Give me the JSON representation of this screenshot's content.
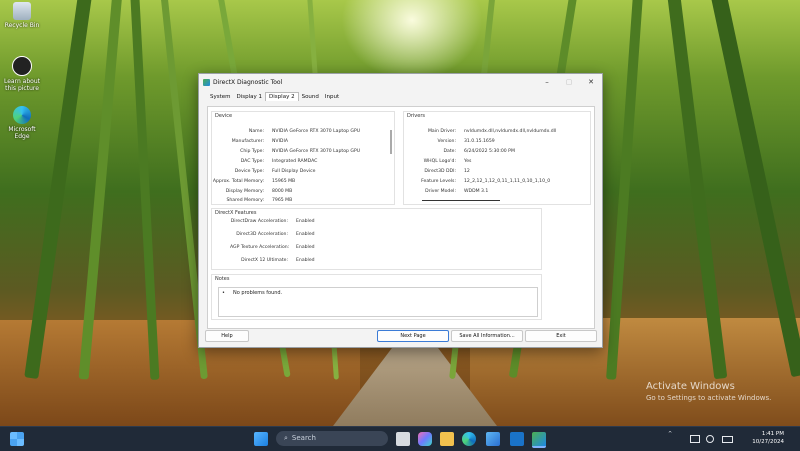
{
  "desktop": {
    "icons": [
      {
        "label": "Recycle Bin",
        "icon": "recycle-bin-icon"
      },
      {
        "label": "Learn about this picture",
        "icon": "learn-about-picture-icon"
      },
      {
        "label": "Microsoft Edge",
        "icon": "edge-icon"
      }
    ],
    "activate": {
      "title": "Activate Windows",
      "subtitle": "Go to Settings to activate Windows."
    }
  },
  "window": {
    "title": "DirectX Diagnostic Tool",
    "controls": {
      "minimize": "–",
      "maximize": "▢",
      "close": "✕"
    },
    "tabs": [
      "System",
      "Display 1",
      "Display 2",
      "Sound",
      "Input"
    ],
    "active_tab": "Display 2",
    "device": {
      "title": "Device",
      "rows": [
        {
          "k": "Name:",
          "v": "NVIDIA GeForce RTX 3070 Laptop GPU"
        },
        {
          "k": "Manufacturer:",
          "v": "NVIDIA"
        },
        {
          "k": "Chip Type:",
          "v": "NVIDIA GeForce RTX 3070 Laptop GPU"
        },
        {
          "k": "DAC Type:",
          "v": "Integrated RAMDAC"
        },
        {
          "k": "Device Type:",
          "v": "Full Display Device"
        },
        {
          "k": "Approx. Total Memory:",
          "v": "15965 MB"
        },
        {
          "k": "Display Memory:",
          "v": "8000 MB"
        },
        {
          "k": "Shared Memory:",
          "v": "7965 MB"
        }
      ]
    },
    "drivers": {
      "title": "Drivers",
      "rows": [
        {
          "k": "Main Driver:",
          "v": "nvldumdx.dll,nvldumdx.dll,nvldumdx.dll"
        },
        {
          "k": "Version:",
          "v": "31.0.15.1659"
        },
        {
          "k": "Date:",
          "v": "6/24/2022 5:30:00 PM"
        },
        {
          "k": "WHQL Logo'd:",
          "v": "Yes"
        },
        {
          "k": "Direct3D DDI:",
          "v": "12"
        },
        {
          "k": "Feature Levels:",
          "v": "12_2,12_1,12_0,11_1,11_0,10_1,10_0"
        },
        {
          "k": "Driver Model:",
          "v": "WDDM 3.1"
        }
      ]
    },
    "features": {
      "title": "DirectX Features",
      "rows": [
        {
          "k": "DirectDraw Acceleration:",
          "v": "Enabled"
        },
        {
          "k": "Direct3D Acceleration:",
          "v": "Enabled"
        },
        {
          "k": "AGP Texture Acceleration:",
          "v": "Enabled"
        },
        {
          "k": "DirectX 12 Ultimate:",
          "v": "Enabled"
        }
      ]
    },
    "notes": {
      "title": "Notes",
      "bullet": "•",
      "text": "No problems found."
    },
    "buttons": {
      "help": "Help",
      "next_page": "Next Page",
      "save_all": "Save All Information...",
      "exit": "Exit"
    }
  },
  "taskbar": {
    "search_placeholder": "Search",
    "search_icon": "search-icon",
    "apps": [
      "start-icon",
      "task-view-icon",
      "copilot-icon",
      "file-explorer-icon",
      "edge-icon",
      "photos-icon",
      "outlook-icon",
      "directx-icon"
    ],
    "tray": {
      "chevron": "^"
    },
    "time": "1:41 PM",
    "date": "10/27/2024"
  },
  "colors": {
    "accent": "#3b7bd6",
    "taskbar": "#202a38",
    "window_bg": "#f3f3f3"
  }
}
